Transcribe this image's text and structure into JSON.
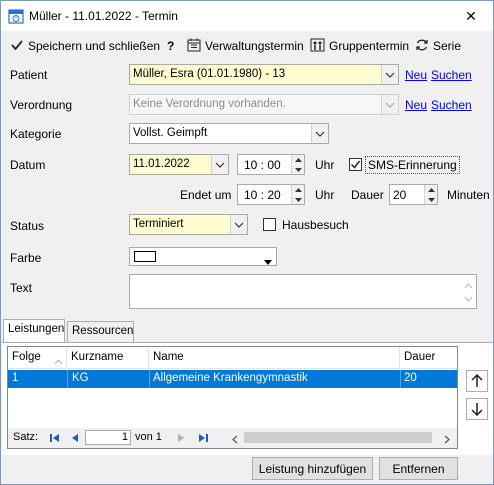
{
  "window": {
    "title": "Müller - 11.01.2022 - Termin",
    "close_glyph": "✕"
  },
  "toolbar": {
    "save_label": "Speichern und schließen",
    "help_label": "?",
    "admin_label": "Verwaltungstermin",
    "group_label": "Gruppentermin",
    "series_label": "Serie"
  },
  "form": {
    "patient_label": "Patient",
    "patient_value": "Müller, Esra (01.01.1980) - 13",
    "new_link": "Neu",
    "search_link": "Suchen",
    "prescription_label": "Verordnung",
    "prescription_value": "Keine Verordnung vorhanden.",
    "category_label": "Kategorie",
    "category_value": "Vollst. Geimpft",
    "date_label": "Datum",
    "date_value": "11.01.2022",
    "start_time": "10 : 00",
    "uhr_label": "Uhr",
    "sms_label": "SMS-Erinnerung",
    "sms_checked": true,
    "end_label": "Endet um",
    "end_time": "10 : 20",
    "duration_label": "Dauer",
    "duration_value": "20",
    "minutes_label": "Minuten",
    "status_label": "Status",
    "status_value": "Terminiert",
    "home_visit_label": "Hausbesuch",
    "home_visit_checked": false,
    "color_label": "Farbe",
    "text_label": "Text"
  },
  "tabs": [
    {
      "label": "Leistungen",
      "active": true
    },
    {
      "label": "Ressourcen",
      "active": false
    }
  ],
  "grid": {
    "columns": [
      "Folge",
      "Kurzname",
      "Name",
      "Dauer"
    ],
    "rows": [
      {
        "folge": "1",
        "kurzname": "KG",
        "name": "Allgemeine Krankengymnastik",
        "dauer": "20"
      }
    ],
    "record_label": "Satz:",
    "record_value": "1",
    "of_label": "von 1"
  },
  "buttons": {
    "add_service": "Leistung hinzufügen",
    "remove": "Entfernen"
  },
  "colors": {
    "accent": "#0078d7",
    "yellow_field": "#fffbd0",
    "link": "#0000ff"
  }
}
